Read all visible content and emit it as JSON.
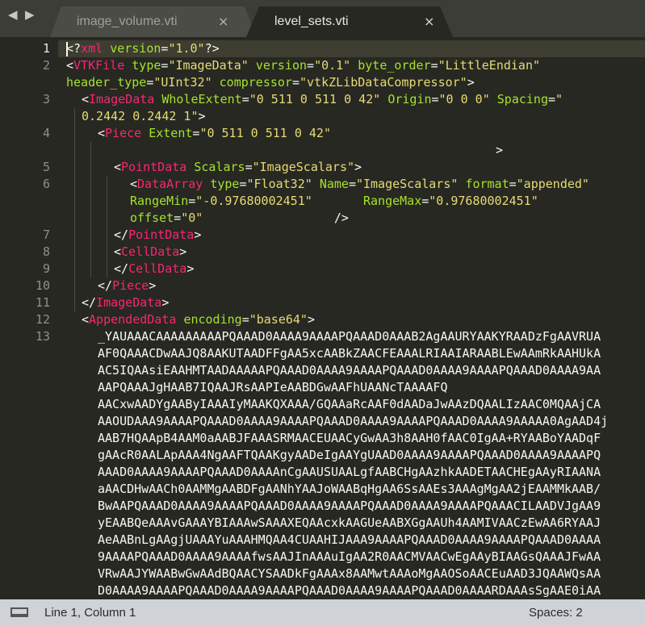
{
  "tabs": [
    {
      "label": "image_volume.vti",
      "close": "×"
    },
    {
      "label": "level_sets.vti",
      "close": "×"
    }
  ],
  "nav": {
    "back": "◀",
    "forward": "▶"
  },
  "line_numbers": [
    "1",
    "2",
    "3",
    "4",
    "5",
    "6",
    "7",
    "8",
    "9",
    "10",
    "11",
    "12",
    "13"
  ],
  "code": {
    "l1": [
      "<?",
      "xml",
      " ",
      "version",
      "=",
      "\"1.0\"",
      "?>"
    ],
    "l2a": [
      "<",
      "VTKFile",
      " ",
      "type",
      "=",
      "\"ImageData\"",
      " ",
      "version",
      "=",
      "\"0.1\"",
      " ",
      "byte_order",
      "=",
      "\"LittleEndian\""
    ],
    "l2b": [
      "header_type",
      "=",
      "\"UInt32\"",
      " ",
      "compressor",
      "=",
      "\"vtkZLibDataCompressor\"",
      ">"
    ],
    "l3a": [
      "<",
      "ImageData",
      " ",
      "WholeExtent",
      "=",
      "\"0 511 0 511 0 42\"",
      " ",
      "Origin",
      "=",
      "\"0 0 0\"",
      " ",
      "Spacing",
      "=",
      "\""
    ],
    "l3b": "0.2442 0.2442 1\"",
    "l3c": ">",
    "l4": [
      "<",
      "Piece",
      " ",
      "Extent",
      "=",
      "\"0 511 0 511 0 42\""
    ],
    "l4b": ">",
    "l5": [
      "<",
      "PointData",
      " ",
      "Scalars",
      "=",
      "\"ImageScalars\"",
      ">"
    ],
    "l6a": [
      "<",
      "DataArray",
      " ",
      "type",
      "=",
      "\"Float32\"",
      " ",
      "Name",
      "=",
      "\"ImageScalars\"",
      " ",
      "format",
      "=",
      "\"appended\""
    ],
    "l6b": [
      "RangeMin",
      "=",
      "\"-0.97680002451\"",
      "       ",
      "RangeMax",
      "=",
      "\"0.97680002451\""
    ],
    "l6c": [
      "offset",
      "=",
      "\"0\"",
      "                  ",
      "/>"
    ],
    "l7": [
      "</",
      "PointData",
      ">"
    ],
    "l8": [
      "<",
      "CellData",
      ">"
    ],
    "l9": [
      "</",
      "CellData",
      ">"
    ],
    "l10": [
      "</",
      "Piece",
      ">"
    ],
    "l11": [
      "</",
      "ImageData",
      ">"
    ],
    "l12": [
      "<",
      "AppendedData",
      " ",
      "encoding",
      "=",
      "\"base64\"",
      ">"
    ],
    "b64": [
      "_YAUAAACAAAAAAAAAPQAAAD0AAAA9AAAAPQAAAD0AAAB2AgAAURYAAKYRAADzFgAAVRUA",
      "AF0QAAACDwAAJQ8AAKUTAADFFgAA5xcAABkZAACFEAAALRIAAIARAABLEwAAmRkAAHUkA",
      "AC5IQAAsiEAAHMTAADAAAAAPQAAAD0AAAA9AAAAPQAAAD0AAAA9AAAAPQAAAD0AAAA9AA",
      "AAPQAAAJgHAAB7IQAAJRsAAPIeAABDGwAAFhUAANcTAAAAFQ",
      "AACxwAADYgAAByIAAAIyMAAKQXAAA/GQAAaRcAAF0dAADaJwAAzDQAALIzAAC0MQAAjCA",
      "AAOUDAAA9AAAAPQAAAD0AAAA9AAAAPQAAAD0AAAA9AAAAPQAAAD0AAAA9AAAAA0AgAAD4j",
      "AAB7HQAApB4AAM0aAABJFAAASRMAACEUAACyGwAA3h8AAH0fAAC0IgAA+RYAABoYAADqF",
      "gAAcR0AALApAAA4NgAAFTQAAKgyAADeIgAAYgUAAD0AAAA9AAAAPQAAAD0AAAA9AAAAPQ",
      "AAAD0AAAA9AAAAPQAAAD0AAAAnCgAAUSUAALgfAABCHgAAzhkAADETAACHEgAAyRIAANA",
      "aAACDHwAACh0AAMMgAABDFgAANhYAAJoWAABqHgAA6SsAAEs3AAAgMgAA2jEAAMMkAAB/",
      "BwAAPQAAAD0AAAA9AAAAPQAAAD0AAAA9AAAAPQAAAD0AAAA9AAAAPQAAACILAADVJgAA9",
      "yEAABQeAAAvGAAAYBIAAAwSAAAXEQAAcxkAAGUeAABXGgAAUh4AAMIVAACzEwAA6RYAAJ",
      "AeAABnLgAAgjUAAAYuAAAHMQAA4CUAAHIJAAA9AAAAPQAAAD0AAAA9AAAAPQAAAD0AAAA",
      "9AAAAPQAAAD0AAAA9AAAAfwsAAJInAAAuIgAA2R0AACMVAACwEgAAyBIAAGsQAAAJFwAA",
      "VRwAAJYWAABwGwAAdBQAACYSAADkFgAAAx8AAMwtAAAoMgAAOSoAACEuAAD3JQAAWQsAA",
      "D0AAAA9AAAAPQAAAD0AAAA9AAAAPQAAAD0AAAA9AAAAPQAAAD0AAAARDAAAsSgAAE0iAA"
    ]
  },
  "status": {
    "position": "Line 1, Column 1",
    "spaces": "Spaces: 2"
  }
}
